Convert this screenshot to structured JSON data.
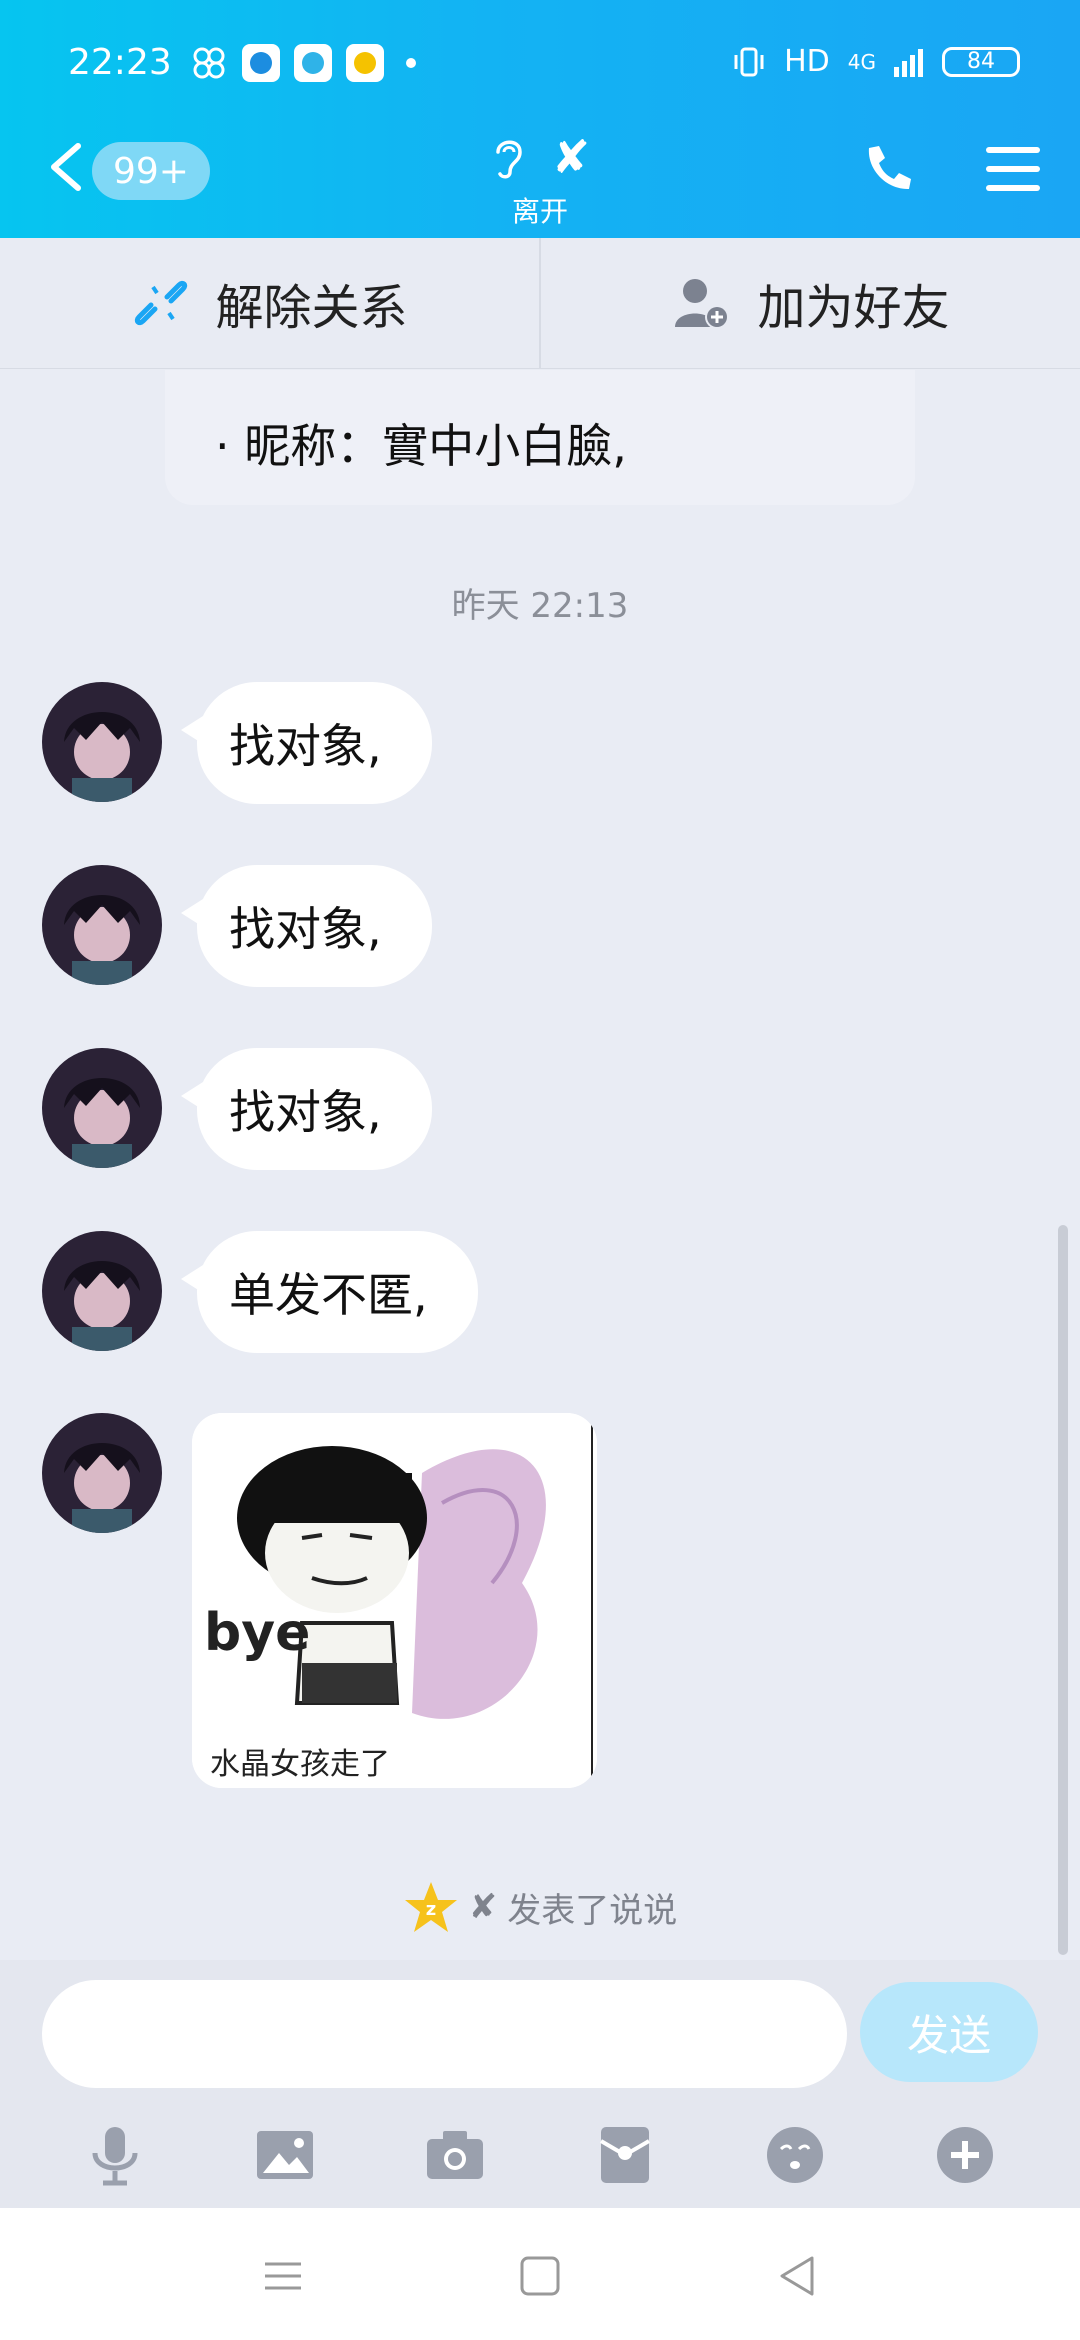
{
  "status_bar": {
    "time": "22:23",
    "network": "HD",
    "signal": "4G",
    "battery": "84"
  },
  "header": {
    "unread_badge": "99+",
    "contact_name_symbol": "✘",
    "contact_status": "离开"
  },
  "actions": {
    "unfriend": "解除关系",
    "add_friend": "加为好友"
  },
  "profile_card": {
    "nickname_line": "· 昵称：實中小白臉,"
  },
  "chat": {
    "timestamp": "昨天 22:13",
    "messages": [
      {
        "text": "找对象,"
      },
      {
        "text": "找对象,"
      },
      {
        "text": "找对象,"
      },
      {
        "text": "单发不匿,"
      }
    ],
    "sticker": {
      "text_bye": "bye",
      "caption": "水晶女孩走了"
    },
    "feed_note": {
      "name_symbol": "✘",
      "text": "发表了说说"
    }
  },
  "composer": {
    "input_placeholder": "",
    "send_label": "发送"
  },
  "colors": {
    "header_start": "#06c5f0",
    "header_end": "#1aa6f4",
    "bubble": "#ffffff",
    "background": "#e9ecf4"
  }
}
